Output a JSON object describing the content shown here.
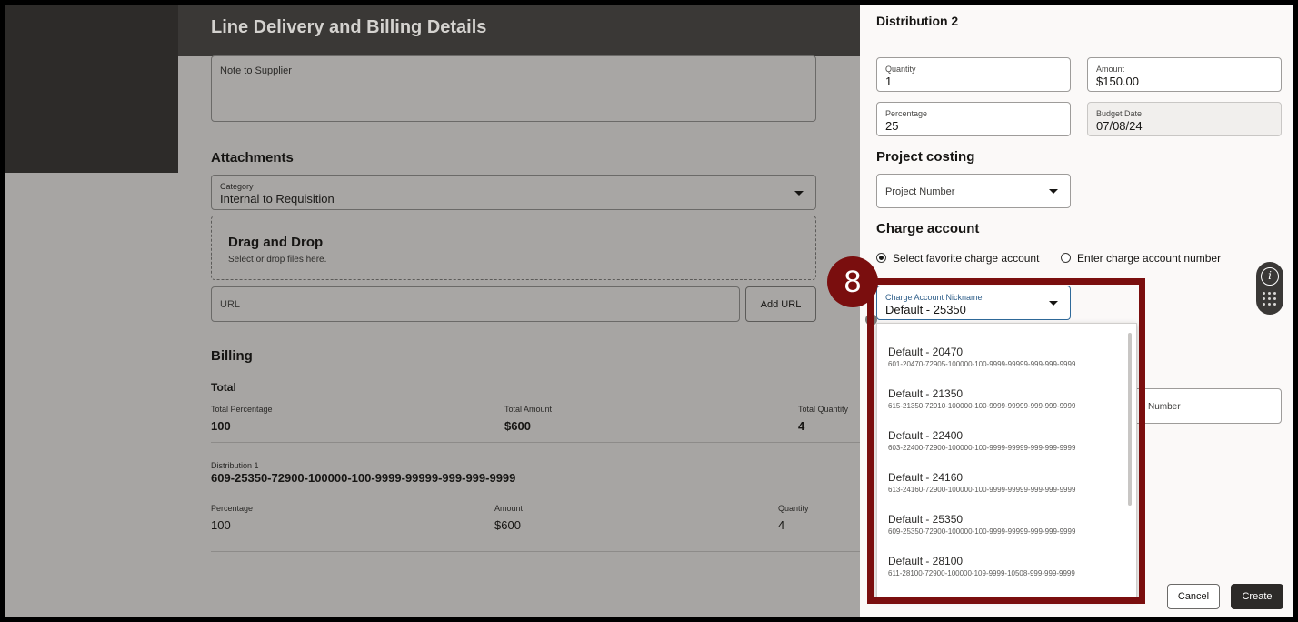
{
  "sheet": {
    "title": "Line Delivery and Billing Details",
    "note_label": "Note to Supplier",
    "attachments_heading": "Attachments",
    "category_label": "Category",
    "category_value": "Internal to Requisition",
    "drop_title": "Drag and Drop",
    "drop_sub": "Select or drop files here.",
    "url_placeholder": "URL",
    "add_url_label": "Add URL",
    "billing_heading": "Billing",
    "total_heading": "Total",
    "total_percentage_label": "Total Percentage",
    "total_percentage": "100",
    "total_amount_label": "Total Amount",
    "total_amount": "$600",
    "total_quantity_label": "Total Quantity",
    "total_quantity": "4",
    "dist1_label": "Distribution 1",
    "dist1_account": "609-25350-72900-100000-100-9999-99999-999-999-9999",
    "pct_label": "Percentage",
    "pct_value": "100",
    "amount_label": "Amount",
    "amount_value": "$600",
    "qty_label": "Quantity",
    "qty_value": "4"
  },
  "panel": {
    "title": "Distribution 2",
    "quantity_label": "Quantity",
    "quantity_value": "1",
    "amount_label": "Amount",
    "amount_value": "$150.00",
    "percentage_label": "Percentage",
    "percentage_value": "25",
    "budget_date_label": "Budget Date",
    "budget_date_value": "07/08/24",
    "project_costing_heading": "Project costing",
    "project_number_placeholder": "Project Number",
    "charge_account_heading": "Charge account",
    "radio_favorite": "Select favorite charge account",
    "radio_enter": "Enter charge account number",
    "nickname_label": "Charge Account Nickname",
    "nickname_value": "Default - 25350",
    "partial_field_text": "Number",
    "cancel_label": "Cancel",
    "create_label": "Create"
  },
  "dropdown": {
    "options": [
      {
        "name": "Default - 20470",
        "account": "601-20470-72905-100000-100-9999-99999-999-999-9999"
      },
      {
        "name": "Default - 21350",
        "account": "615-21350-72910-100000-100-9999-99999-999-999-9999"
      },
      {
        "name": "Default - 22400",
        "account": "603-22400-72900-100000-100-9999-99999-999-999-9999"
      },
      {
        "name": "Default - 24160",
        "account": "613-24160-72900-100000-100-9999-99999-999-999-9999"
      },
      {
        "name": "Default - 25350",
        "account": "609-25350-72900-100000-100-9999-99999-999-999-9999"
      },
      {
        "name": "Default - 28100",
        "account": "611-28100-72900-100000-109-9999-10508-999-999-9999"
      }
    ]
  },
  "callout": {
    "step_number": "8",
    "color": "#7a0e0e"
  },
  "icons": [
    "info-icon",
    "dots-grid-icon",
    "chevron-down-icon"
  ]
}
